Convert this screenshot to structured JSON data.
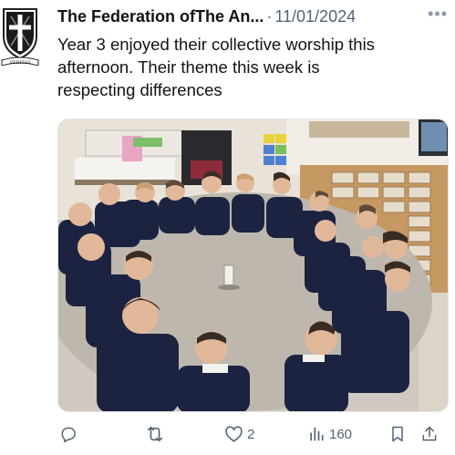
{
  "tweet": {
    "author_name": "The Federation ofThe An...",
    "separator": "·",
    "date": "11/01/2024",
    "more_label": "•••",
    "text_line1": "Year 3 enjoyed their collective worship this",
    "text_line2": "afternoon. Their theme this week is",
    "text_line3": "respecting differences",
    "crest_motto": "VERITAS"
  },
  "actions": {
    "reply_count": "",
    "retweet_count": "",
    "like_count": "2",
    "views_count": "160"
  },
  "icons": {
    "reply": "reply-icon",
    "retweet": "retweet-icon",
    "like": "heart-icon",
    "views": "views-icon",
    "bookmark": "bookmark-icon",
    "share": "share-icon"
  },
  "colors": {
    "text": "#0f1419",
    "muted": "#536471"
  }
}
